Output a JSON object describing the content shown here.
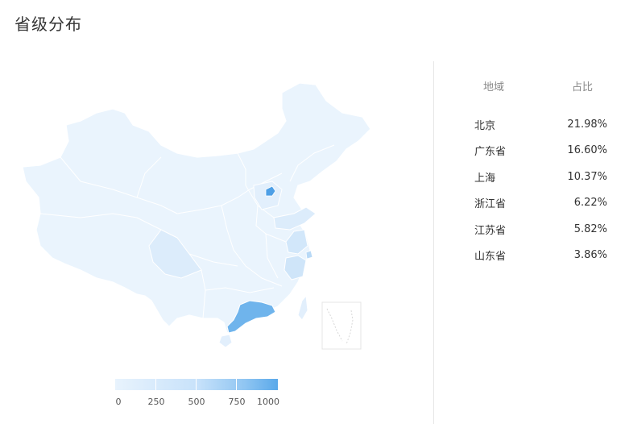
{
  "page": {
    "title": "省级分布"
  },
  "map": {
    "colors": {
      "base": "#e8f3fd",
      "border": "#ffffff",
      "light": "#dcecfb",
      "mid": "#c5e0f8",
      "highlight": "#5aa9ea",
      "guangdong": "#6fb4ec"
    }
  },
  "legend": {
    "labels": [
      "0",
      "250",
      "500",
      "750",
      "1000"
    ],
    "min": 0,
    "max": 1000
  },
  "table": {
    "header": {
      "region": "地域",
      "share": "占比"
    },
    "rows": [
      {
        "region": "北京",
        "share": "21.98%"
      },
      {
        "region": "广东省",
        "share": "16.60%"
      },
      {
        "region": "上海",
        "share": "10.37%"
      },
      {
        "region": "浙江省",
        "share": "6.22%"
      },
      {
        "region": "江苏省",
        "share": "5.82%"
      },
      {
        "region": "山东省",
        "share": "3.86%"
      }
    ]
  }
}
